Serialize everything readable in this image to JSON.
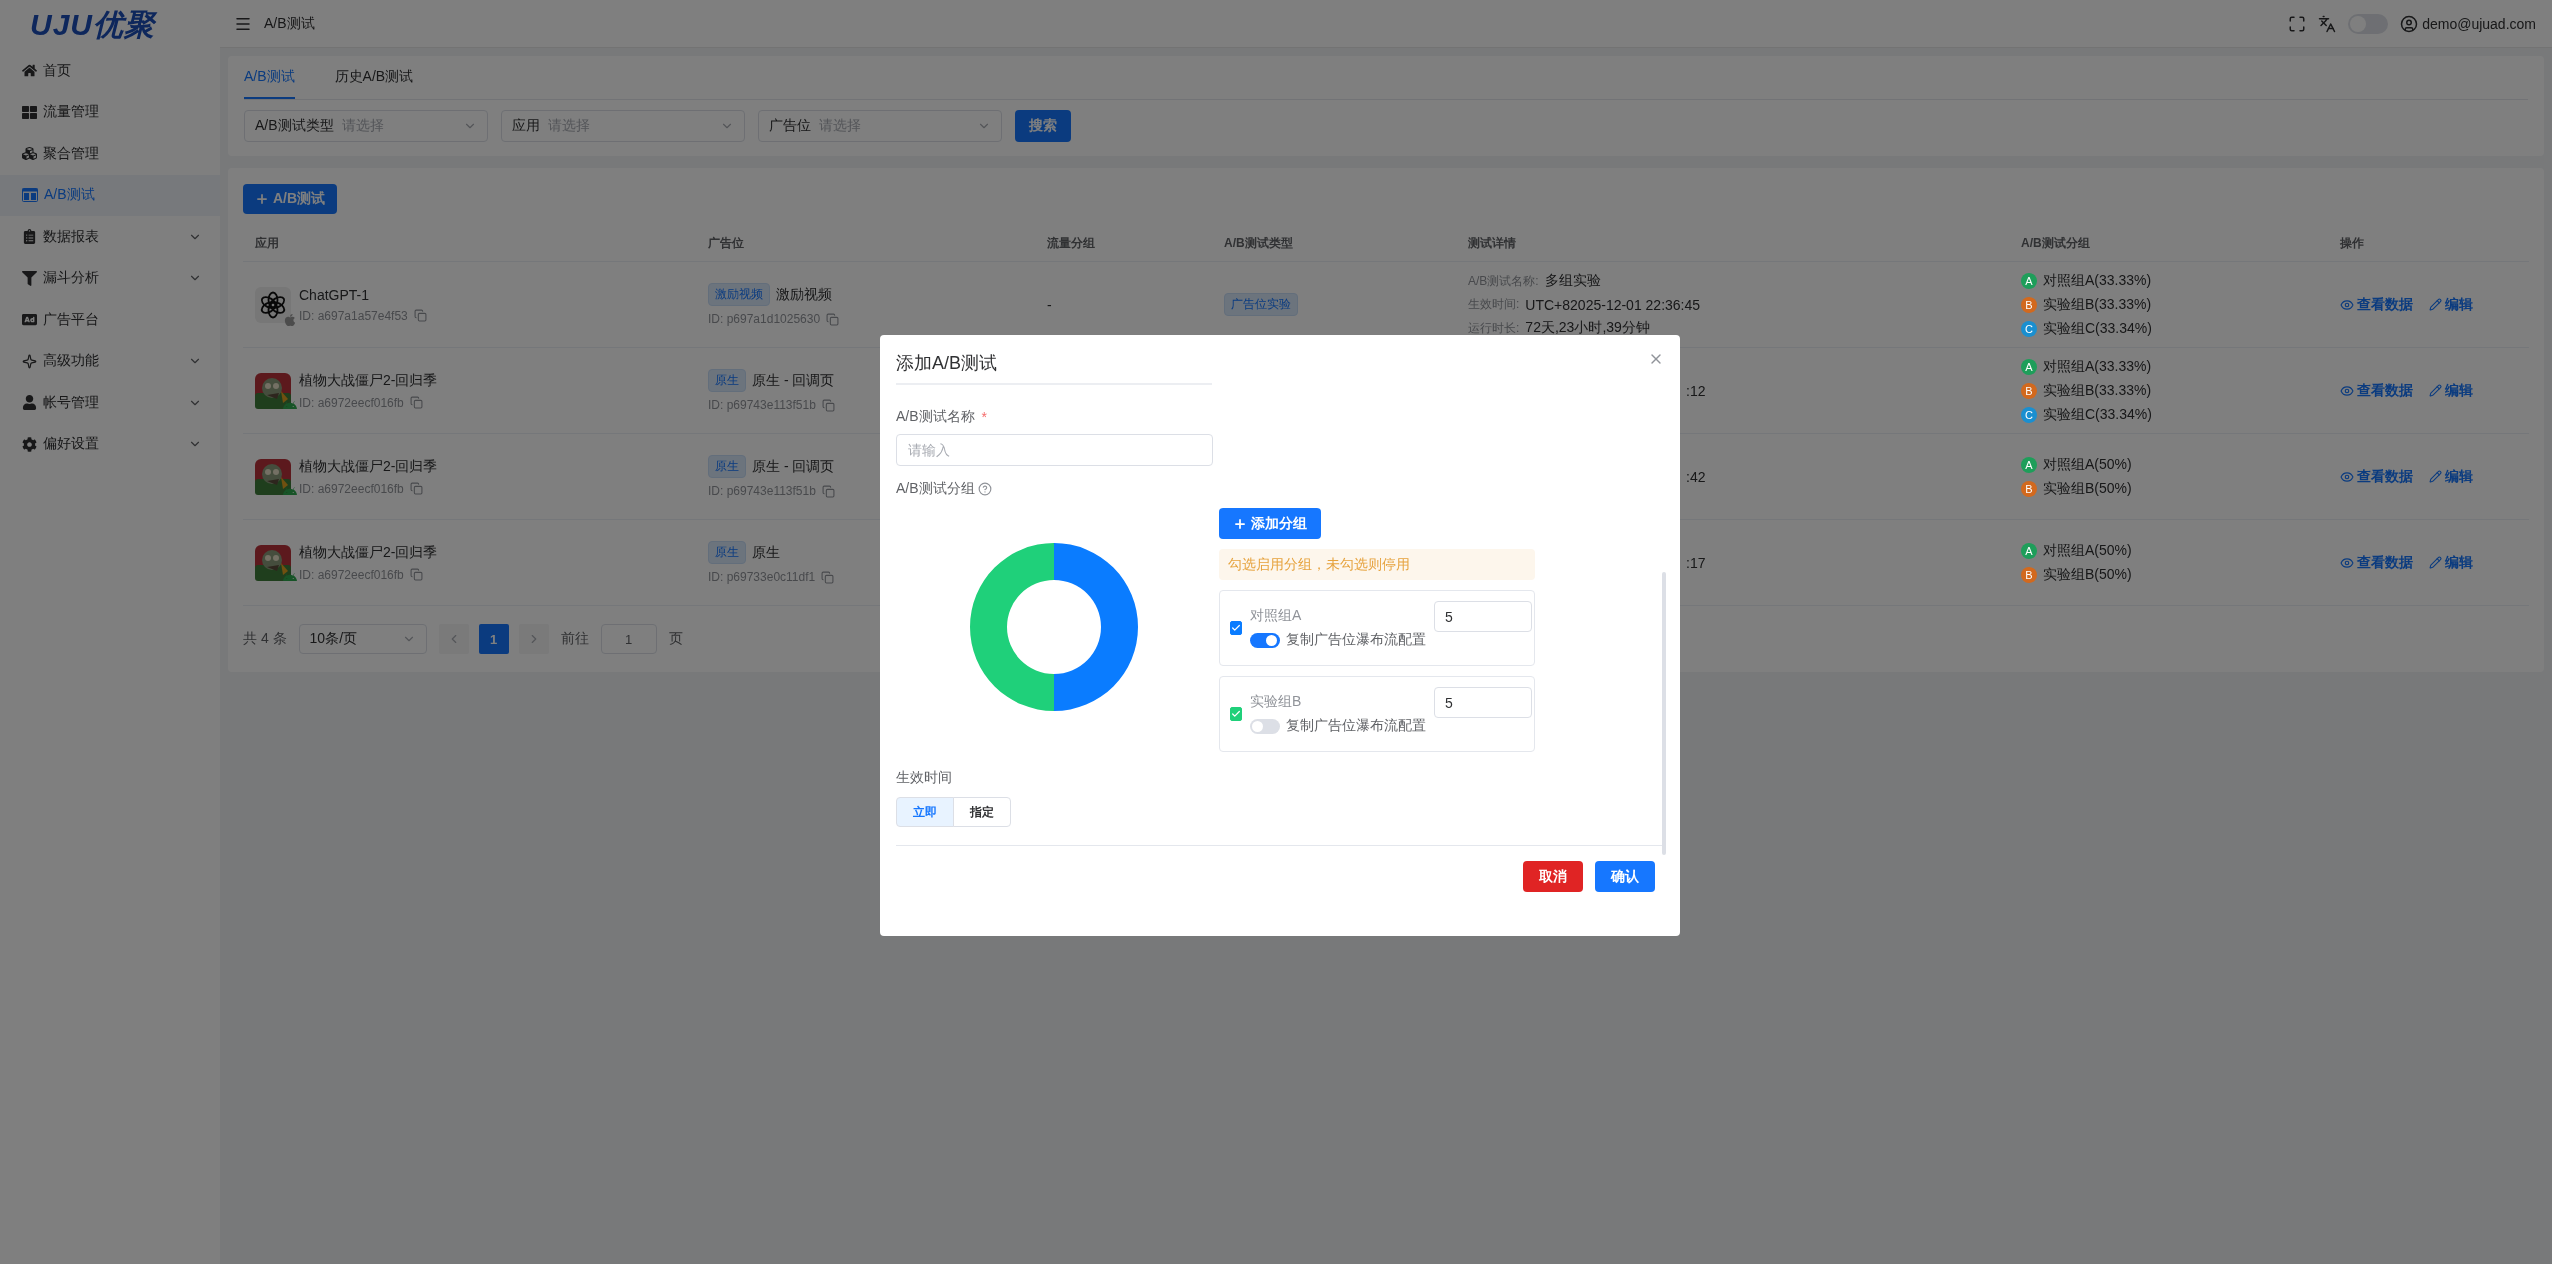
{
  "logo": "UJU优聚",
  "sidebar": {
    "items": [
      {
        "label": "首页",
        "selected": false,
        "expandable": false
      },
      {
        "label": "流量管理",
        "selected": false,
        "expandable": false
      },
      {
        "label": "聚合管理",
        "selected": false,
        "expandable": false
      },
      {
        "label": "A/B测试",
        "selected": true,
        "expandable": false
      },
      {
        "label": "数据报表",
        "selected": false,
        "expandable": true
      },
      {
        "label": "漏斗分析",
        "selected": false,
        "expandable": true
      },
      {
        "label": "广告平台",
        "selected": false,
        "expandable": false
      },
      {
        "label": "高级功能",
        "selected": false,
        "expandable": true
      },
      {
        "label": "帐号管理",
        "selected": false,
        "expandable": true
      },
      {
        "label": "偏好设置",
        "selected": false,
        "expandable": true
      }
    ]
  },
  "header": {
    "breadcrumb": "A/B测试",
    "theme_toggle_on": false,
    "user": "demo@ujuad.com"
  },
  "tabs": [
    {
      "label": "A/B测试",
      "selected": true
    },
    {
      "label": "历史A/B测试",
      "selected": false
    }
  ],
  "filters": [
    {
      "label": "A/B测试类型",
      "placeholder": "请选择"
    },
    {
      "label": "应用",
      "placeholder": "请选择"
    },
    {
      "label": "广告位",
      "placeholder": "请选择"
    }
  ],
  "search_button": "搜索",
  "add_button": "A/B测试",
  "table": {
    "columns": [
      "应用",
      "广告位",
      "流量分组",
      "A/B测试类型",
      "测试详情",
      "A/B测试分组",
      "操作"
    ],
    "rows": [
      {
        "app": "ChatGPT-1",
        "app_id": "ID: a697a1a57e4f53",
        "kind": "logo",
        "placement_tag": "激励视频",
        "placement": "激励视频",
        "placement_id": "ID: p697a1d1025630",
        "traffic": "-",
        "type_tag": "广告位实验",
        "details": [
          {
            "label": "A/B测试名称:",
            "value": "多组实验"
          },
          {
            "label": "生效时间:",
            "value": "UTC+82025-12-01 22:36:45"
          },
          {
            "label": "运行时长:",
            "value": "72天,23小时,39分钟"
          }
        ],
        "groups": [
          {
            "letter": "A",
            "label": "对照组A(33.33%)",
            "color": "#1e9e5a"
          },
          {
            "letter": "B",
            "label": "实验组B(33.33%)",
            "color": "#d2691e"
          },
          {
            "letter": "C",
            "label": "实验组C(33.34%)",
            "color": "#1a8fd0"
          }
        ],
        "actions": [
          "查看数据",
          "编辑"
        ]
      },
      {
        "app": "植物大战僵尸2-回归季",
        "app_id": "ID: a6972eecf016fb",
        "kind": "picture",
        "placement_tag": "原生",
        "placement": "原生 - 回调页",
        "placement_id": "ID: p69743e113f51b",
        "detail_fragment": ":12",
        "groups": [
          {
            "letter": "A",
            "label": "对照组A(33.33%)",
            "color": "#1e9e5a"
          },
          {
            "letter": "B",
            "label": "实验组B(33.33%)",
            "color": "#d2691e"
          },
          {
            "letter": "C",
            "label": "实验组C(33.34%)",
            "color": "#1a8fd0"
          }
        ],
        "actions": [
          "查看数据",
          "编辑"
        ]
      },
      {
        "app": "植物大战僵尸2-回归季",
        "app_id": "ID: a6972eecf016fb",
        "kind": "picture",
        "placement_tag": "原生",
        "placement": "原生 - 回调页",
        "placement_id": "ID: p69743e113f51b",
        "detail_fragment": ":42",
        "groups": [
          {
            "letter": "A",
            "label": "对照组A(50%)",
            "color": "#1e9e5a"
          },
          {
            "letter": "B",
            "label": "实验组B(50%)",
            "color": "#d2691e"
          }
        ],
        "actions": [
          "查看数据",
          "编辑"
        ]
      },
      {
        "app": "植物大战僵尸2-回归季",
        "app_id": "ID: a6972eecf016fb",
        "kind": "picture",
        "placement_tag": "原生",
        "placement": "原生",
        "placement_id": "ID: p69733e0c11df1",
        "detail_fragment": ":17",
        "groups": [
          {
            "letter": "A",
            "label": "对照组A(50%)",
            "color": "#1e9e5a"
          },
          {
            "letter": "B",
            "label": "实验组B(50%)",
            "color": "#d2691e"
          }
        ],
        "actions": [
          "查看数据",
          "编辑"
        ]
      }
    ]
  },
  "pagination": {
    "total": "共 4 条",
    "page_size": "10条/页",
    "pages": [
      {
        "label": "1",
        "selected": true
      }
    ],
    "goto_label": "前往",
    "goto_value": "1",
    "goto_suffix": "页"
  },
  "modal": {
    "title": "添加A/B测试",
    "name_label": "A/B测试名称",
    "required_mark": "*",
    "name_placeholder": "请输入",
    "groups_label": "A/B测试分组",
    "add_group_button": "添加分组",
    "hint": "勾选启用分组，未勾选则停用",
    "groups": [
      {
        "name": "对照组A",
        "value": "5",
        "checked": true,
        "color": "#0a7cff",
        "copy_label": "复制广告位瀑布流配置",
        "copy_on": true
      },
      {
        "name": "实验组B",
        "value": "5",
        "checked": true,
        "color": "#1fd07a",
        "copy_label": "复制广告位瀑布流配置",
        "copy_on": false
      }
    ],
    "time_label": "生效时间",
    "time_options": [
      {
        "label": "立即",
        "selected": true
      },
      {
        "label": "指定",
        "selected": false
      }
    ],
    "cancel": "取消",
    "confirm": "确认"
  }
}
